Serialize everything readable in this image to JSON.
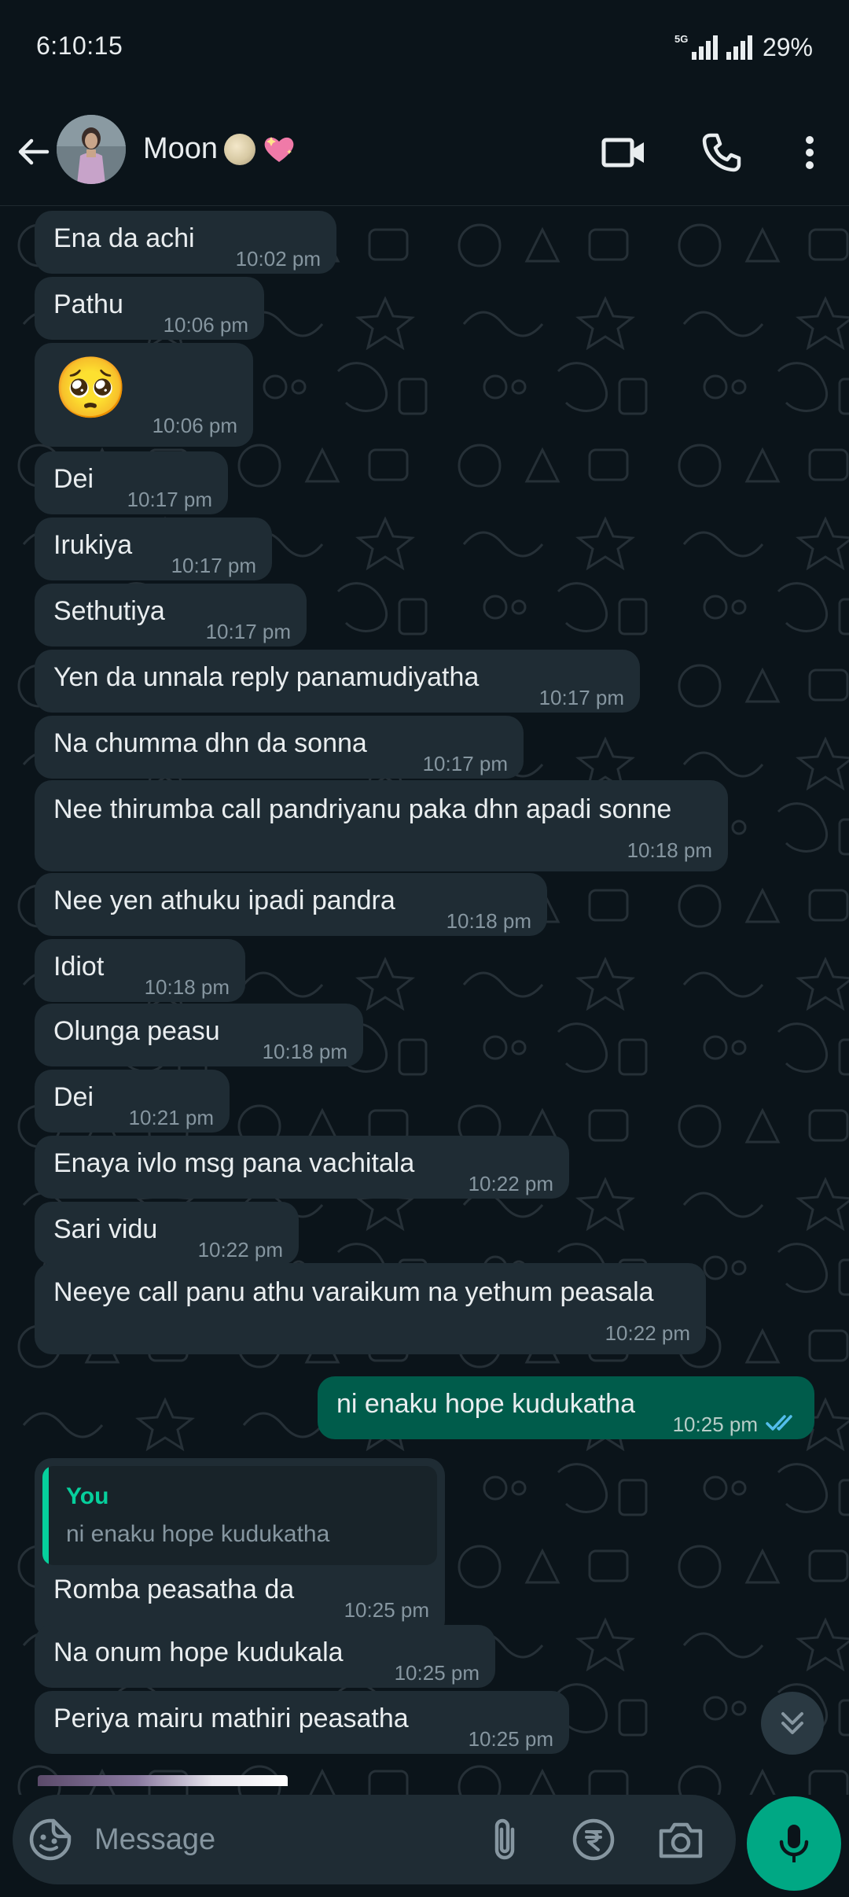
{
  "status_bar": {
    "time": "6:10:15",
    "network": "5G",
    "battery": "29%"
  },
  "header": {
    "contact_name": "Moon",
    "name_emojis": [
      "full-moon-emoji",
      "sparkling-heart-emoji"
    ],
    "icons": [
      "back-arrow-icon",
      "video-call-icon",
      "voice-call-icon",
      "more-options-icon"
    ]
  },
  "messages": [
    {
      "direction": "incoming",
      "text": "Ena da achi",
      "time": "10:02 pm"
    },
    {
      "direction": "incoming",
      "text": "Pathu",
      "time": "10:06 pm"
    },
    {
      "direction": "incoming",
      "text": "🥺",
      "time": "10:06 pm"
    },
    {
      "direction": "incoming",
      "text": "Dei",
      "time": "10:17 pm"
    },
    {
      "direction": "incoming",
      "text": "Irukiya",
      "time": "10:17 pm"
    },
    {
      "direction": "incoming",
      "text": "Sethutiya",
      "time": "10:17 pm"
    },
    {
      "direction": "incoming",
      "text": "Yen da unnala reply panamudiyatha",
      "time": "10:17 pm"
    },
    {
      "direction": "incoming",
      "text": "Na chumma dhn da sonna",
      "time": "10:17 pm"
    },
    {
      "direction": "incoming",
      "text": "Nee thirumba call pandriyanu paka dhn apadi sonne",
      "time": "10:18 pm"
    },
    {
      "direction": "incoming",
      "text": "Nee yen athuku ipadi pandra",
      "time": "10:18 pm"
    },
    {
      "direction": "incoming",
      "text": "Idiot",
      "time": "10:18 pm"
    },
    {
      "direction": "incoming",
      "text": "Olunga peasu",
      "time": "10:18 pm"
    },
    {
      "direction": "incoming",
      "text": "Dei",
      "time": "10:21 pm"
    },
    {
      "direction": "incoming",
      "text": "Enaya ivlo msg pana vachitala",
      "time": "10:22 pm"
    },
    {
      "direction": "incoming",
      "text": "Sari vidu",
      "time": "10:22 pm"
    },
    {
      "direction": "incoming",
      "text": "Neeye call panu athu varaikum na yethum peasala",
      "time": "10:22 pm"
    },
    {
      "direction": "outgoing",
      "text": "ni enaku hope kudukatha",
      "time": "10:25 pm",
      "status": "read"
    },
    {
      "direction": "incoming",
      "text": "Romba peasatha da",
      "time": "10:25 pm",
      "reply_to": {
        "author": "You",
        "text": "ni enaku hope kudukatha"
      }
    },
    {
      "direction": "incoming",
      "text": "Na onum hope kudukala",
      "time": "10:25 pm"
    },
    {
      "direction": "incoming",
      "text": "Periya mairu mathiri peasatha",
      "time": "10:25 pm"
    }
  ],
  "composer": {
    "placeholder": "Message",
    "icons": [
      "emoji-sticker-icon",
      "attach-icon",
      "rupee-payment-icon",
      "camera-icon",
      "mic-icon"
    ]
  },
  "colors": {
    "background": "#0b141a",
    "incoming_bubble": "#1f2c34",
    "outgoing_bubble": "#005c4b",
    "accent": "#00a884",
    "read_tick": "#53bdeb",
    "timestamp": "#8696a0"
  }
}
